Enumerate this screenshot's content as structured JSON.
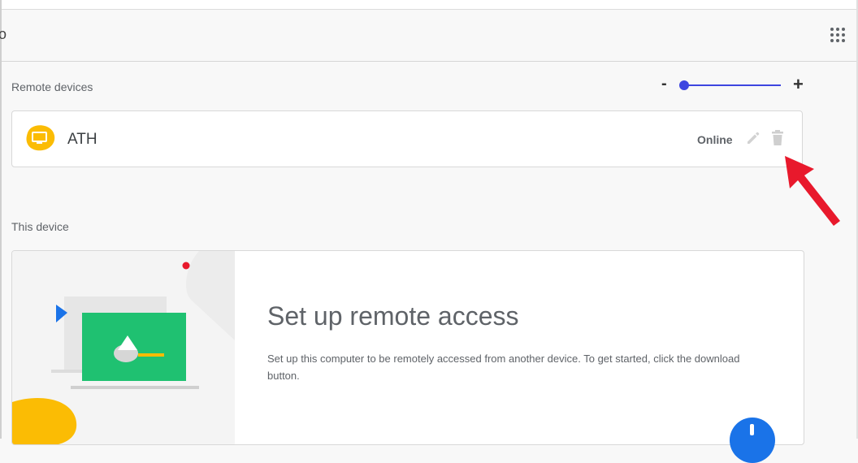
{
  "app": {
    "logo_fragment": "o"
  },
  "remote_devices": {
    "title": "Remote devices",
    "zoom": {
      "minus": "-",
      "plus": "+",
      "level": 0.0
    },
    "devices": [
      {
        "name": "ATH",
        "status": "Online",
        "icon": "monitor-icon"
      }
    ]
  },
  "this_device": {
    "title": "This device",
    "setup": {
      "heading": "Set up remote access",
      "description": "Set up this computer to be remotely accessed from another device. To get started, click the download button."
    }
  },
  "colors": {
    "accent": "#3d46e0",
    "fab": "#1a73e8",
    "device_icon": "#fbbc04",
    "annotation_arrow": "#e8192c",
    "illustration_green": "#1fc171"
  }
}
